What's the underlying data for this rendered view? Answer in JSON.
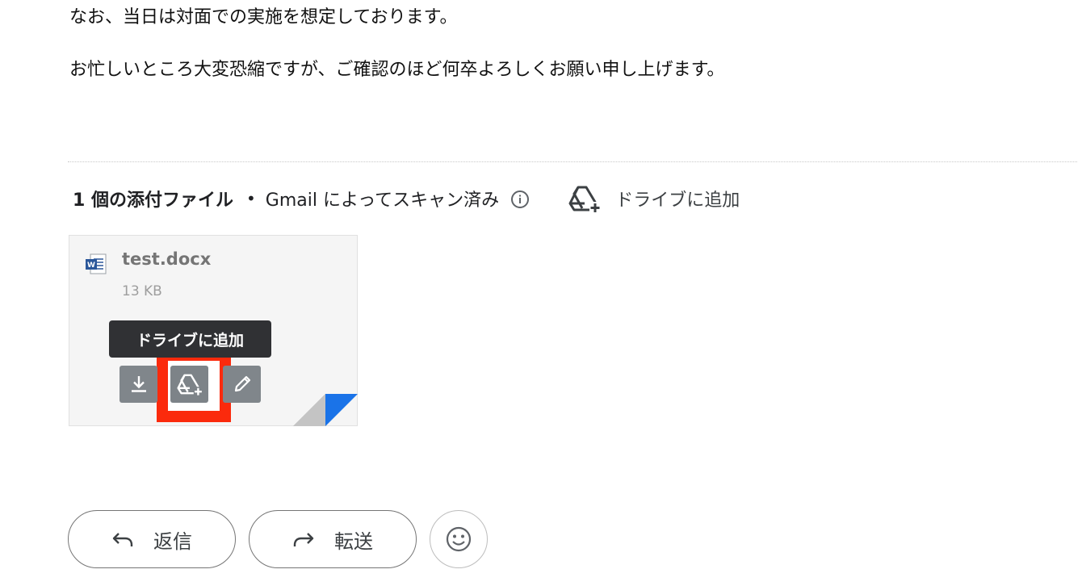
{
  "message": {
    "line1": "なお、当日は対面での実施を想定しております。",
    "line2": "お忙しいところ大変恐縮ですが、ご確認のほど何卒よろしくお願い申し上げます。"
  },
  "attachments": {
    "count_label": "1 個の添付ファイル",
    "separator": "•",
    "scan_label": "Gmail によってスキャン済み",
    "drive_add_label": "ドライブに追加",
    "file": {
      "name": "test.docx",
      "size": "13 KB"
    },
    "tooltip": "ドライブに追加"
  },
  "actions": {
    "reply_label": "返信",
    "forward_label": "転送"
  },
  "colors": {
    "highlight": "#fb2a0c",
    "word_blue": "#2b579a",
    "fold_blue": "#1a73e8"
  }
}
